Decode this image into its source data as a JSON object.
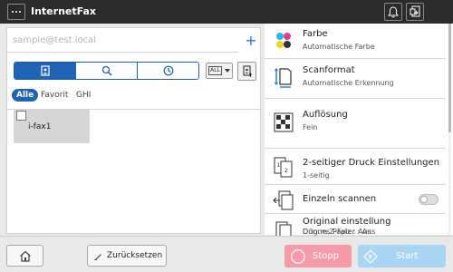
{
  "app": {
    "title": "InternetFax"
  },
  "address": {
    "placeholder": "sample@test.local",
    "add_label": "+"
  },
  "view_controls": {
    "all_dropdown": "ALL"
  },
  "filters": [
    "Alle",
    "Favorit",
    "GHI"
  ],
  "destinations": [
    {
      "label": "i-fax1",
      "checked": false
    }
  ],
  "settings": {
    "color": {
      "title": "Farbe",
      "value": "Automatische Farbe"
    },
    "scan_format": {
      "title": "Scanformat",
      "value": "Automatische Erkennung"
    },
    "resolution": {
      "title": "Auflösung",
      "value": "Fein"
    },
    "duplex": {
      "title": "2-seitiger Druck Einstellungen",
      "value": "1-seitig"
    },
    "single_scan": {
      "title": "Einzeln scannen",
      "enabled": false
    },
    "original": {
      "title": "Original einstellung",
      "line1": "Dünnes Papier : Aus",
      "line2": "Orig.m.Z-Falz : Aus"
    }
  },
  "bottom": {
    "reset_label": "Zurücksetzen",
    "stop_label": "Stopp",
    "start_label": "Start"
  },
  "colors": {
    "accent": "#1f63b3",
    "stop": "#f59aa8",
    "start": "#a9d4f2",
    "titlebar": "#2b2b2b"
  }
}
